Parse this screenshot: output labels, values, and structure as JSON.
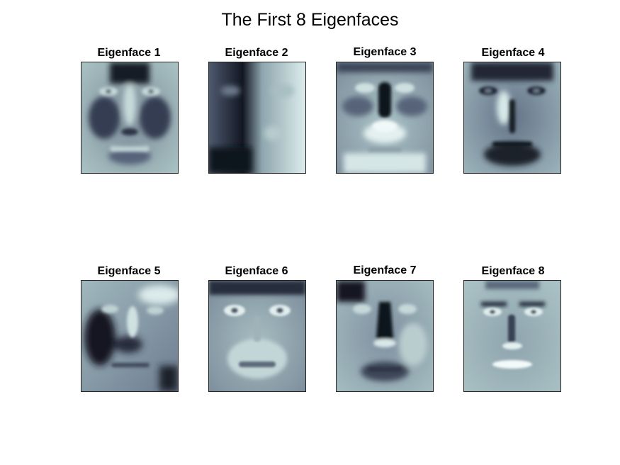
{
  "figure": {
    "title": "The First 8 Eigenfaces",
    "colormap": "bone",
    "panels": [
      {
        "title": "Eigenface 1"
      },
      {
        "title": "Eigenface 2"
      },
      {
        "title": "Eigenface 3"
      },
      {
        "title": "Eigenface 4"
      },
      {
        "title": "Eigenface 5"
      },
      {
        "title": "Eigenface 6"
      },
      {
        "title": "Eigenface 7"
      },
      {
        "title": "Eigenface 8"
      }
    ]
  }
}
